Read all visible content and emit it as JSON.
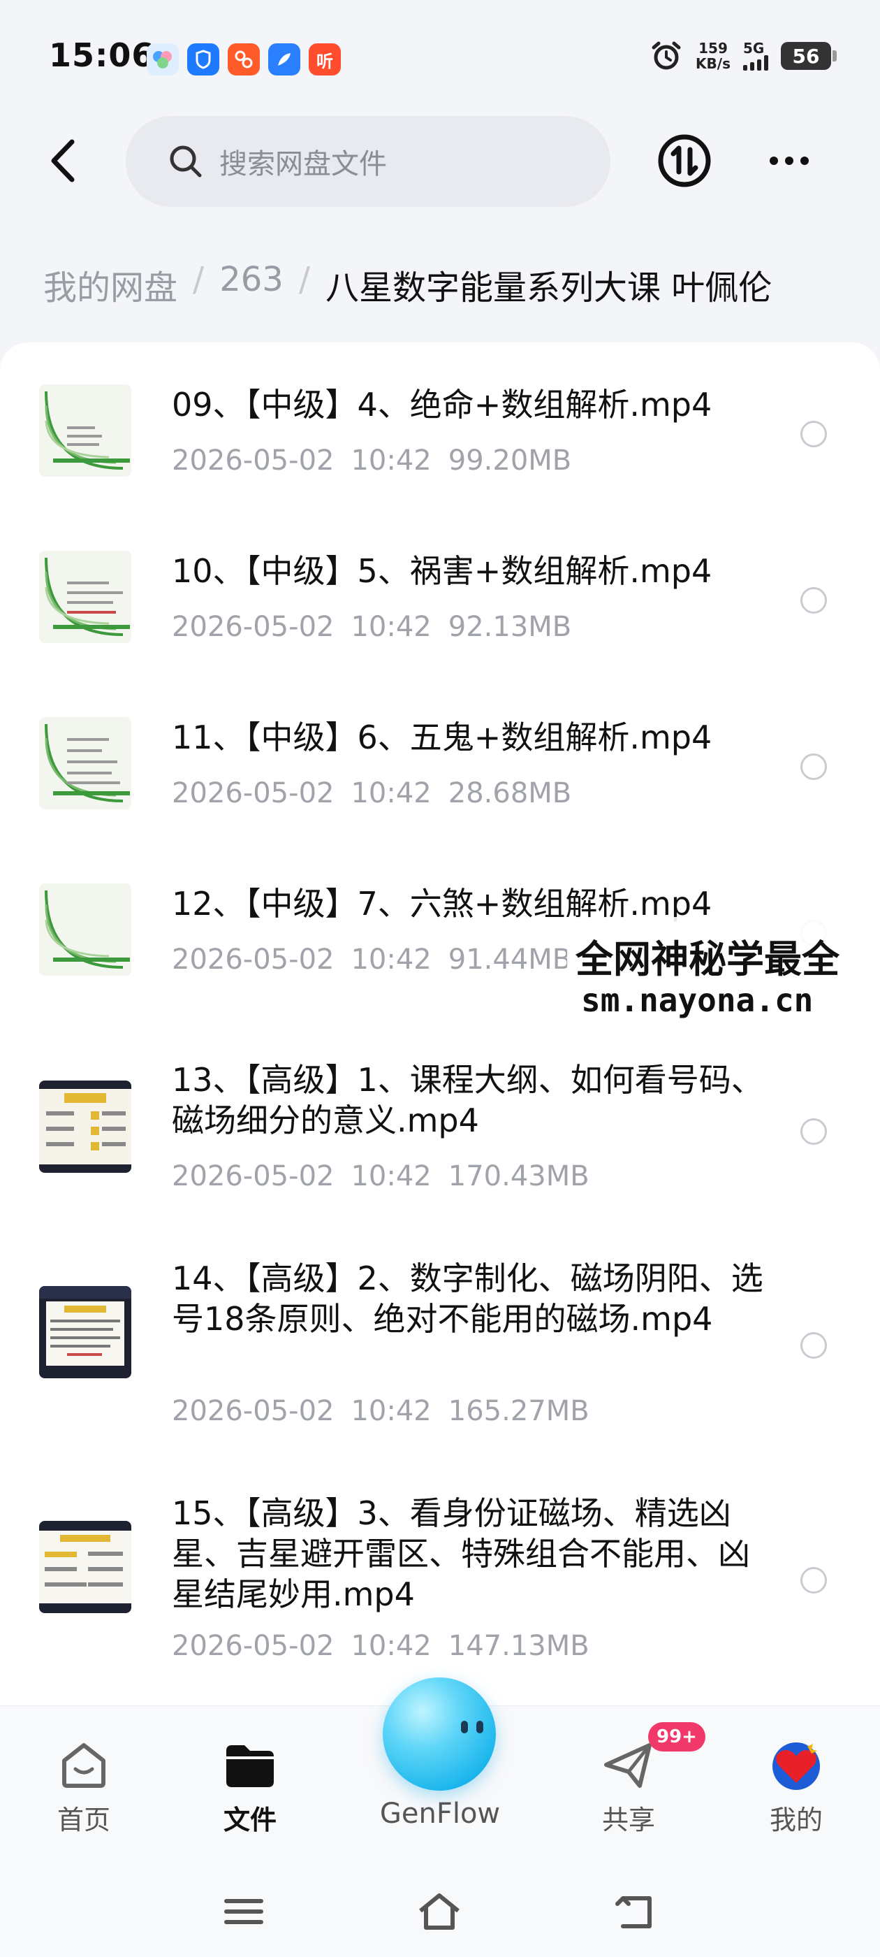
{
  "status_bar": {
    "time": "15:06",
    "net_speed_value": "159",
    "net_speed_unit": "KB/s",
    "network": "5G",
    "battery": "56",
    "app_icons": [
      "genflow-app-icon",
      "shield-app-icon",
      "mascot-app-icon",
      "feather-app-icon",
      "listen-app-icon"
    ],
    "listen_app_char": "听"
  },
  "header": {
    "search_placeholder": "搜索网盘文件"
  },
  "breadcrumb": {
    "root": "我的网盘",
    "middle": "263",
    "separator": "/",
    "current": "八星数字能量系列大课 叶佩伦"
  },
  "files": [
    {
      "name": "09、【中级】4、绝命+数组解析.mp4",
      "date": "2026-05-02",
      "time": "10:42",
      "size": "99.20MB",
      "thumb": "light"
    },
    {
      "name": "10、【中级】5、祸害+数组解析.mp4",
      "date": "2026-05-02",
      "time": "10:42",
      "size": "92.13MB",
      "thumb": "light"
    },
    {
      "name": "11、【中级】6、五鬼+数组解析.mp4",
      "date": "2026-05-02",
      "time": "10:42",
      "size": "28.68MB",
      "thumb": "light"
    },
    {
      "name": "12、【中级】7、六煞+数组解析.mp4",
      "date": "2026-05-02",
      "time": "10:42",
      "size": "91.44MB",
      "thumb": "light"
    },
    {
      "name": "13、【高级】1、课程大纲、如何看号码、磁场细分的意义.mp4",
      "date": "2026-05-02",
      "time": "10:42",
      "size": "170.43MB",
      "thumb": "dark"
    },
    {
      "name": "14、【高级】2、数字制化、磁场阴阳、选号18条原则、绝对不能用的磁场.mp4",
      "date": "2026-05-02",
      "time": "10:42",
      "size": "165.27MB",
      "thumb": "dark"
    },
    {
      "name": "15、【高级】3、看身份证磁场、精选凶星、吉星避开雷区、特殊组合不能用、凶星结尾妙用.mp4",
      "date": "2026-05-02",
      "time": "10:42",
      "size": "147.13MB",
      "thumb": "dark"
    }
  ],
  "watermark": {
    "line1": "全网神秘学最全",
    "line2": "sm.nayona.cn"
  },
  "bottom_nav": {
    "home": "首页",
    "files": "文件",
    "genflow": "GenFlow",
    "share": "共享",
    "share_badge": "99+",
    "mine": "我的"
  },
  "colors": {
    "accent_blue": "#1cb6ec",
    "badge_red": "#f0386b"
  }
}
